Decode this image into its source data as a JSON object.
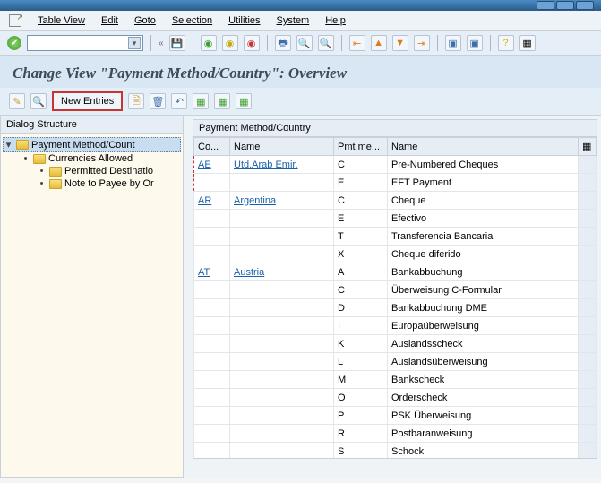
{
  "window": {
    "min": "_",
    "restore": "❐",
    "close": "✕"
  },
  "menu": {
    "items": [
      "Table View",
      "Edit",
      "Goto",
      "Selection",
      "Utilities",
      "System",
      "Help"
    ]
  },
  "page_title": "Change View \"Payment Method/Country\": Overview",
  "toolbar2": {
    "new_entries": "New Entries"
  },
  "tree": {
    "header": "Dialog Structure",
    "root": "Payment Method/Count",
    "children": [
      "Currencies Allowed",
      "Permitted Destinatio",
      "Note to Payee by Or"
    ]
  },
  "grid": {
    "title": "Payment Method/Country",
    "headers": {
      "co": "Co...",
      "name": "Name",
      "pm": "Pmt me...",
      "desc": "Name"
    },
    "rows": [
      {
        "co": "AE",
        "name": "Utd.Arab Emir.",
        "pm": "C",
        "desc": "Pre-Numbered Cheques"
      },
      {
        "co": "",
        "name": "",
        "pm": "E",
        "desc": "EFT Payment"
      },
      {
        "co": "AR",
        "name": "Argentina",
        "pm": "C",
        "desc": "Cheque"
      },
      {
        "co": "",
        "name": "",
        "pm": "E",
        "desc": "Efectivo"
      },
      {
        "co": "",
        "name": "",
        "pm": "T",
        "desc": "Transferencia Bancaria"
      },
      {
        "co": "",
        "name": "",
        "pm": "X",
        "desc": "Cheque diferido"
      },
      {
        "co": "AT",
        "name": "Austria",
        "pm": "A",
        "desc": "Bankabbuchung"
      },
      {
        "co": "",
        "name": "",
        "pm": "C",
        "desc": "Überweisung C-Formular"
      },
      {
        "co": "",
        "name": "",
        "pm": "D",
        "desc": "Bankabbuchung DME"
      },
      {
        "co": "",
        "name": "",
        "pm": "I",
        "desc": "Europaüberweisung"
      },
      {
        "co": "",
        "name": "",
        "pm": "K",
        "desc": "Auslandsscheck"
      },
      {
        "co": "",
        "name": "",
        "pm": "L",
        "desc": "Auslandsüberweisung"
      },
      {
        "co": "",
        "name": "",
        "pm": "M",
        "desc": "Bankscheck"
      },
      {
        "co": "",
        "name": "",
        "pm": "O",
        "desc": "Orderscheck"
      },
      {
        "co": "",
        "name": "",
        "pm": "P",
        "desc": "PSK Überweisung"
      },
      {
        "co": "",
        "name": "",
        "pm": "R",
        "desc": "Postbaranweisung"
      },
      {
        "co": "",
        "name": "",
        "pm": "S",
        "desc": "Schock"
      }
    ]
  }
}
